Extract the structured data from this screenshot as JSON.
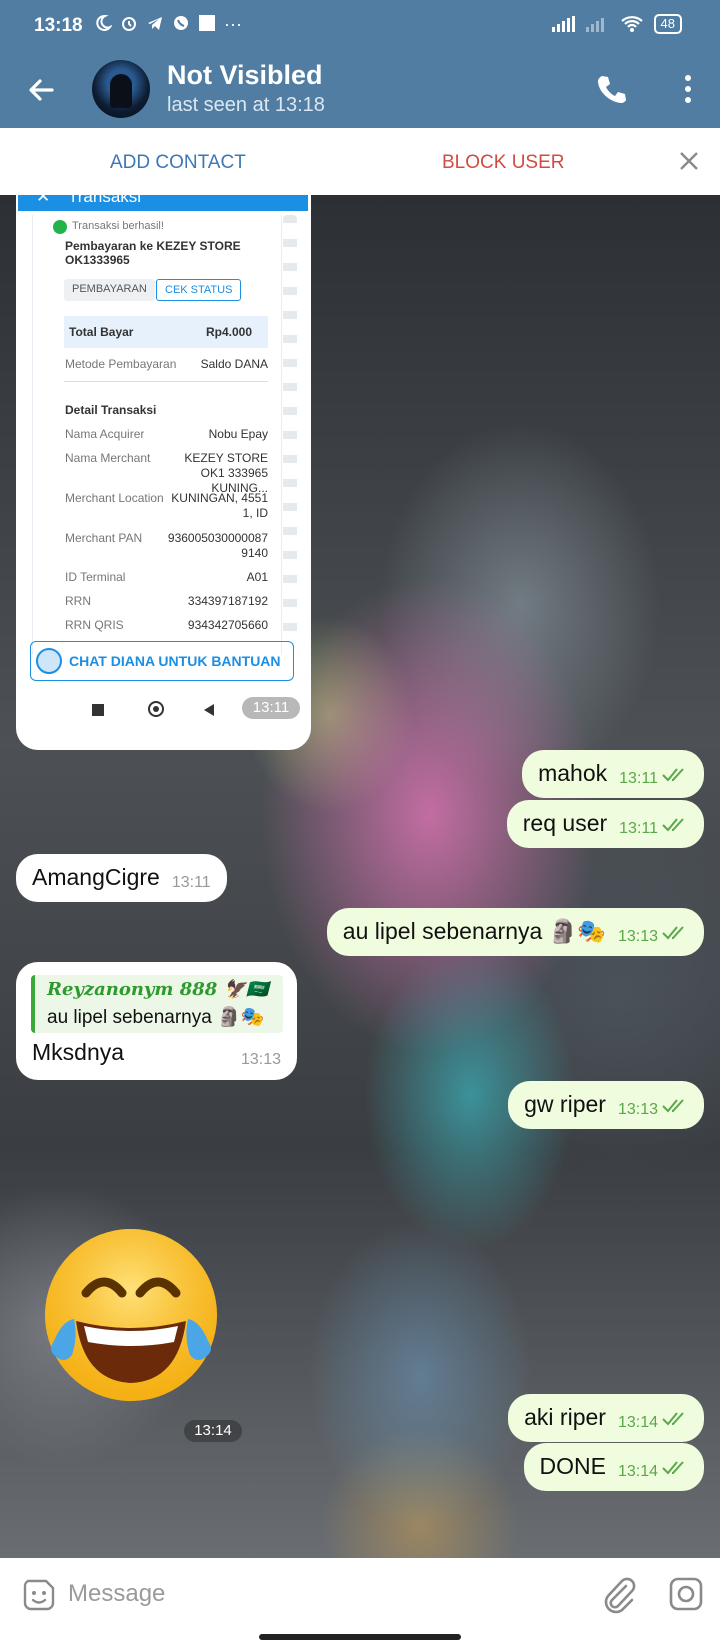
{
  "status_bar": {
    "time": "13:18",
    "battery": "48",
    "overflow": "···"
  },
  "header": {
    "title": "Not Visibled",
    "subtitle": "last seen at 13:18"
  },
  "action_bar": {
    "add_contact": "ADD CONTACT",
    "block_user": "BLOCK USER"
  },
  "screenshot": {
    "top_title": "Transaksi",
    "success": "Transaksi berhasil!",
    "payment_to": "Pembayaran ke KEZEY STORE OK1333965",
    "chip_type": "PEMBAYARAN",
    "chip_status": "CEK STATUS",
    "total_label": "Total Bayar",
    "total_value": "Rp4.000",
    "method_label": "Metode Pembayaran",
    "method_value": "Saldo DANA",
    "detail_title": "Detail Transaksi",
    "rows": [
      {
        "label": "Nama Acquirer",
        "value": "Nobu Epay"
      },
      {
        "label": "Nama Merchant",
        "value": "KEZEY STORE OK1 333965 KUNING..."
      },
      {
        "label": "Merchant Location",
        "value": "KUNINGAN, 4551 1, ID"
      },
      {
        "label": "Merchant PAN",
        "value": "936005030000087 9140"
      },
      {
        "label": "ID Terminal",
        "value": "A01"
      },
      {
        "label": "RRN",
        "value": "334397187192"
      },
      {
        "label": "RRN QRIS",
        "value": "934342705660"
      }
    ],
    "help_button": "CHAT DIANA UNTUK BANTUAN",
    "time": "13:11"
  },
  "messages": [
    {
      "text": "mahok",
      "time": "13:11"
    },
    {
      "text": "req user",
      "time": "13:11"
    },
    {
      "text": "AmangCigre",
      "time": "13:11"
    },
    {
      "text": "au lipel sebenarnya 🗿🎭",
      "time": "13:13"
    },
    {
      "text": "gw riper",
      "time": "13:13"
    },
    {
      "text": "aki riper",
      "time": "13:14"
    },
    {
      "text": "DONE",
      "time": "13:14"
    }
  ],
  "reply": {
    "quote_name": "Reyzanonym 888 🦅🇸🇦",
    "quote_text": "au lipel sebenarnya 🗿🎭",
    "text": "Mksdnya",
    "time": "13:13"
  },
  "emoji_message": {
    "emoji": "😂",
    "time": "13:14"
  },
  "input": {
    "placeholder": "Message"
  },
  "colors": {
    "header": "#527da3",
    "outgoing": "#effdde",
    "incoming": "#ffffff",
    "accent": "#3e77b6",
    "danger": "#d24a43"
  }
}
